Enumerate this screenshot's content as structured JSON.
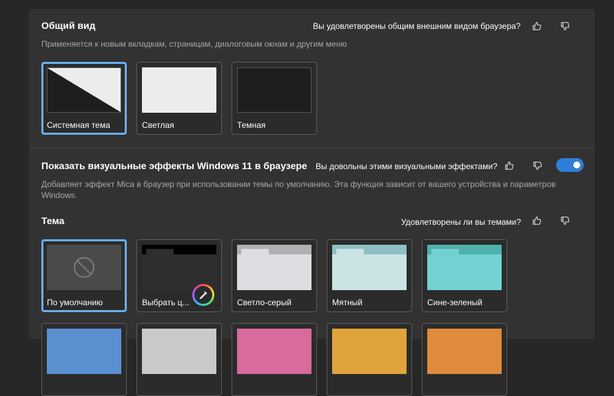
{
  "appearance": {
    "title": "Общий вид",
    "question": "Вы удовлетворены общим внешним видом браузера?",
    "description": "Применяется к новым вкладкам, страницам, диалоговым окнам и другим меню",
    "options": [
      {
        "label": "Системная тема",
        "selected": true
      },
      {
        "label": "Светлая",
        "selected": false
      },
      {
        "label": "Темная",
        "selected": false
      }
    ]
  },
  "visual_effects": {
    "title": "Показать визуальные эффекты Windows 11 в браузере",
    "question": "Вы довольны этими визуальными эффектами?",
    "description": "Добавляет эффект Mica в браузер при использовании темы по умолчанию. Эта функция зависит от вашего устройства и параметров Windows.",
    "enabled": true
  },
  "theme": {
    "title": "Тема",
    "question": "Удовлетворены ли вы темами?",
    "options": [
      {
        "label": "По умолчанию",
        "selected": true
      },
      {
        "label": "Выбрать ц...",
        "selected": false
      },
      {
        "label": "Светло-серый",
        "selected": false
      },
      {
        "label": "Мятный",
        "selected": false
      },
      {
        "label": "Сине-зеленый",
        "selected": false
      }
    ]
  },
  "colors": {
    "accent": "#6aaff0",
    "toggle_on": "#2f7fd6",
    "light_gray_tab": "#aeb0b4",
    "light_gray_body": "#dcdde0",
    "mint_tab": "#8ec0c4",
    "mint_body": "#cce3e5",
    "teal_tab": "#4fb0ad",
    "teal_body": "#73d2d1"
  },
  "icons": [
    "thumbs-up-icon",
    "thumbs-down-icon",
    "no-theme-icon",
    "color-picker-icon"
  ]
}
